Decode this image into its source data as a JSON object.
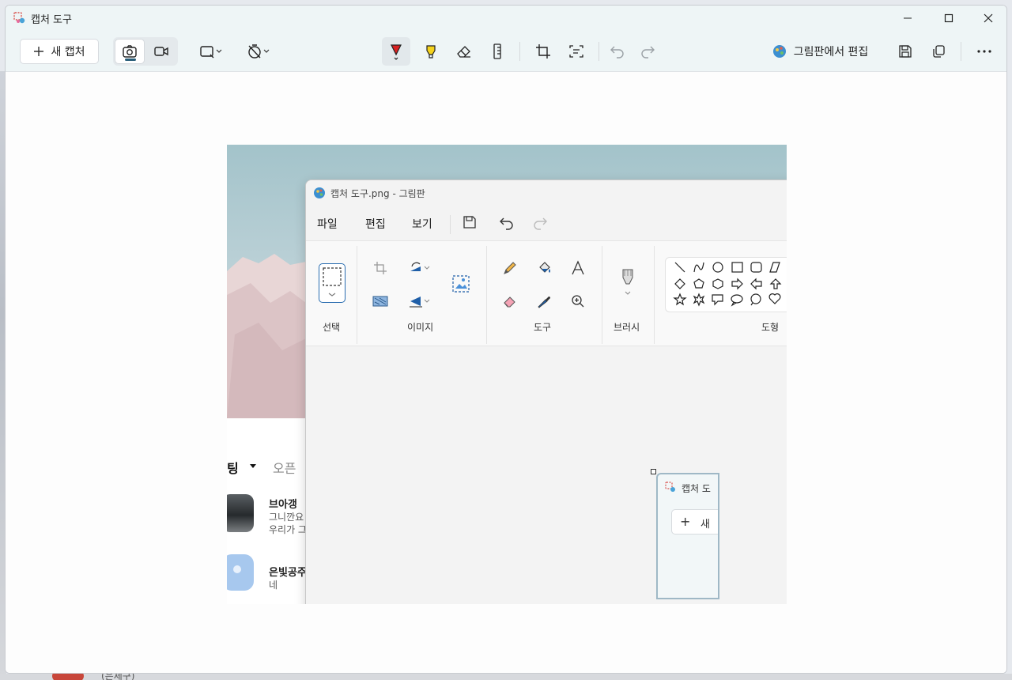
{
  "window": {
    "title": "캡처 도구",
    "controls": {
      "minimize": "minimize-icon",
      "maximize": "maximize-icon",
      "close": "close-icon"
    }
  },
  "toolbar": {
    "new_capture_label": "새 캡처",
    "mode": {
      "photo": "camera-icon",
      "video": "video-icon",
      "selected": "photo"
    },
    "shape_dropdown": "rectangle-snip-icon",
    "delay_dropdown": "no-timer-icon",
    "tools": [
      "ballpoint-pen-icon",
      "highlighter-icon",
      "eraser-icon",
      "ruler-icon",
      "crop-icon",
      "text-actions-icon",
      "undo-icon",
      "redo-icon"
    ],
    "open_in_paint_label": "그림판에서 편집",
    "save": "save-icon",
    "copy": "copy-icon",
    "more": "more-icon"
  },
  "capture": {
    "feed": {
      "tab_active": "팅",
      "tab_inactive": "오픈",
      "items": [
        {
          "name": "브아갱",
          "line1": "그니깐요",
          "line2": "우리가 그"
        },
        {
          "name": "은빛공주",
          "line1": "네"
        }
      ]
    },
    "paint": {
      "title": "캡처 도구.png - 그림판",
      "menu": [
        "파일",
        "편집",
        "보기"
      ],
      "groups": [
        "선택",
        "이미지",
        "도구",
        "브러시",
        "도형"
      ]
    },
    "nested": {
      "title": "캡처 도",
      "new_label": "새"
    }
  },
  "background": {
    "peek_text": "(은체구)"
  },
  "colors": {
    "accent": "#2a5f7a",
    "chrome": "#eef5f6",
    "pen_red": "#d92121",
    "highlighter": "#f5d31c"
  }
}
